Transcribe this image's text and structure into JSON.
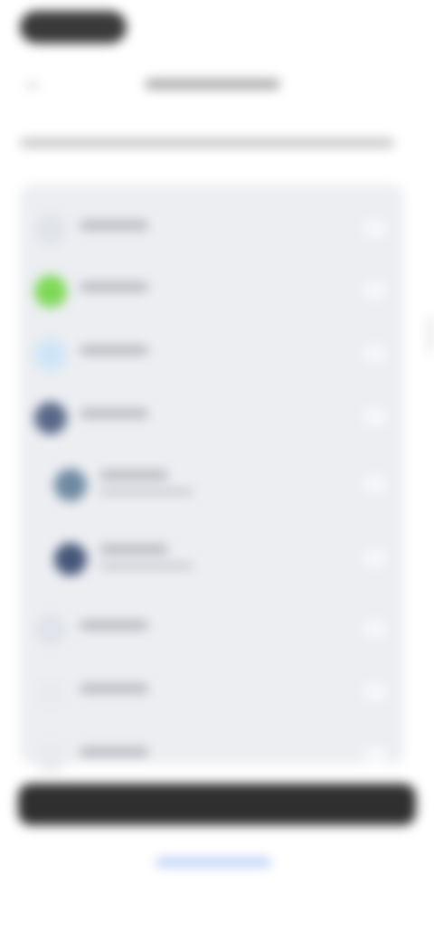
{
  "status_bar": {
    "pill_color": "#3a3a3a"
  },
  "header": {
    "back_icon": "arrow-left-icon",
    "title": ""
  },
  "subtitle": "",
  "list": {
    "rows": [
      {
        "icon": "generic-icon",
        "icon_color": "#e1e4ea",
        "label": "",
        "indent": false,
        "has_subtext": false
      },
      {
        "icon": "app-icon-green",
        "icon_color": "#7ed957",
        "label": "",
        "indent": false,
        "has_subtext": false
      },
      {
        "icon": "app-icon-light-blue",
        "icon_color": "#cfe6f7",
        "label": "",
        "indent": false,
        "has_subtext": false
      },
      {
        "icon": "app-icon-dark-blue",
        "icon_color": "#5a6888",
        "label": "",
        "indent": false,
        "has_subtext": false
      },
      {
        "icon": "app-icon-blue-green",
        "icon_color": "#6f8aa2",
        "label": "",
        "indent": true,
        "has_subtext": true
      },
      {
        "icon": "app-icon-navy",
        "icon_color": "#46567a",
        "label": "",
        "indent": true,
        "has_subtext": true
      },
      {
        "icon": "generic-icon",
        "icon_color": "#e1e4ea",
        "label": "",
        "indent": false,
        "has_subtext": false
      },
      {
        "icon": "generic-icon",
        "icon_color": "#e9ebef",
        "label": "",
        "indent": false,
        "has_subtext": false
      },
      {
        "icon": "generic-icon",
        "icon_color": "#e9ebef",
        "label": "",
        "indent": false,
        "has_subtext": false
      }
    ]
  },
  "bottom_bar": {
    "color": "#2f2f2f"
  },
  "footer_link": {
    "text": "",
    "color": "#2f6fe0"
  }
}
